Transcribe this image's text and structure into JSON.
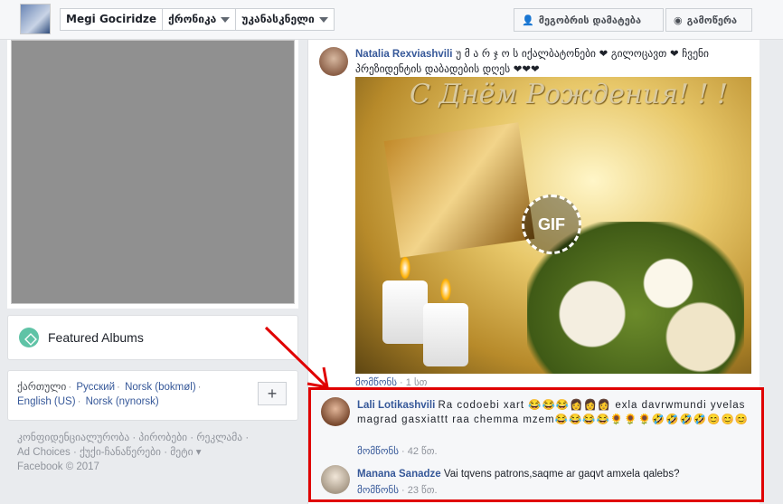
{
  "topbar": {
    "profile_name": "Megi Gociridze",
    "tab_timeline": "ქრონიკა",
    "tab_recent": "უკანასკნელი",
    "add_friend": "მეგობრის დამატება",
    "follow": "გამოწერა"
  },
  "featured": {
    "label": "Featured Albums"
  },
  "languages": {
    "current": "ქართული",
    "items": [
      "Русский",
      "Norsk (bokmøl)",
      "English (US)",
      "Norsk (nynorsk)"
    ],
    "add": "+"
  },
  "footer": {
    "line1": "კონფიდენციალურობა · პირობები · რეკლამა ·",
    "line2": "Ad Choices · ქუქი-ჩანაწერები · მეტი ▾",
    "line3": "Facebook © 2017"
  },
  "post": {
    "author": "Natalia Rexviashvili",
    "text": "უ მ ა რ ჯ ო ს იქალბატონები ❤ გილოცავთ ❤ ჩვენი პრეზიდენტის დაბადების დღეს ❤❤❤",
    "gif_title": "С Днём Рождения! ! !",
    "gif_badge": "GIF",
    "like": "მომწონს",
    "time": "1 სთ"
  },
  "comments": [
    {
      "author": "Lali Lotikashvili",
      "text": "Ra codoebi xart 😂😂😂👩👩👩 exla davrwmundi yvelas magrad gasxiattt raa chemma mzem😂😂😂😂🌻🌻🌻🤣🤣🤣🤣😊😊😊",
      "like": "მომწონს",
      "time": "42 წთ."
    },
    {
      "author": "Manana Sanadze",
      "text": "Vai tqvens patrons,saqme ar gaqvt amxela qalebs?",
      "like": "მომწონს",
      "time": "23 წთ."
    }
  ],
  "colors": {
    "accent": "#365899",
    "highlight": "#e00000"
  }
}
